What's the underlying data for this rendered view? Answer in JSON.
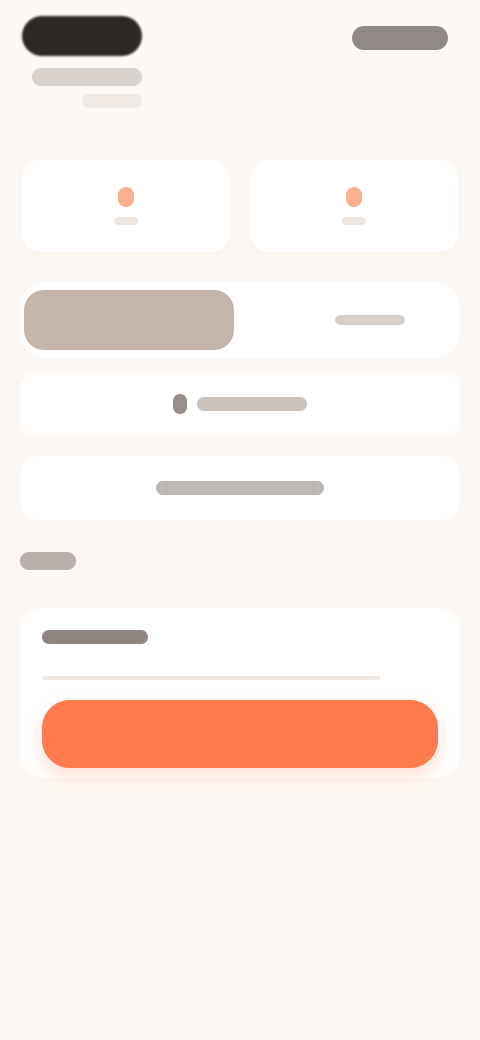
{
  "header": {
    "brand_label": "",
    "link_label": "",
    "subtitle": ""
  },
  "steps": [
    {
      "label": ""
    },
    {
      "label": ""
    }
  ],
  "segment": {
    "active_label": "",
    "inactive_label": ""
  },
  "options": [
    {
      "label": ""
    },
    {
      "label": ""
    }
  ],
  "section": {
    "label": ""
  },
  "form": {
    "input_label": "",
    "input_value": "",
    "cta_label": ""
  },
  "colors": {
    "background": "#fdf8f3",
    "accent": "#ff7a4d",
    "segment_active": "#c4b4aa",
    "step_marker": "#f7a27a"
  }
}
